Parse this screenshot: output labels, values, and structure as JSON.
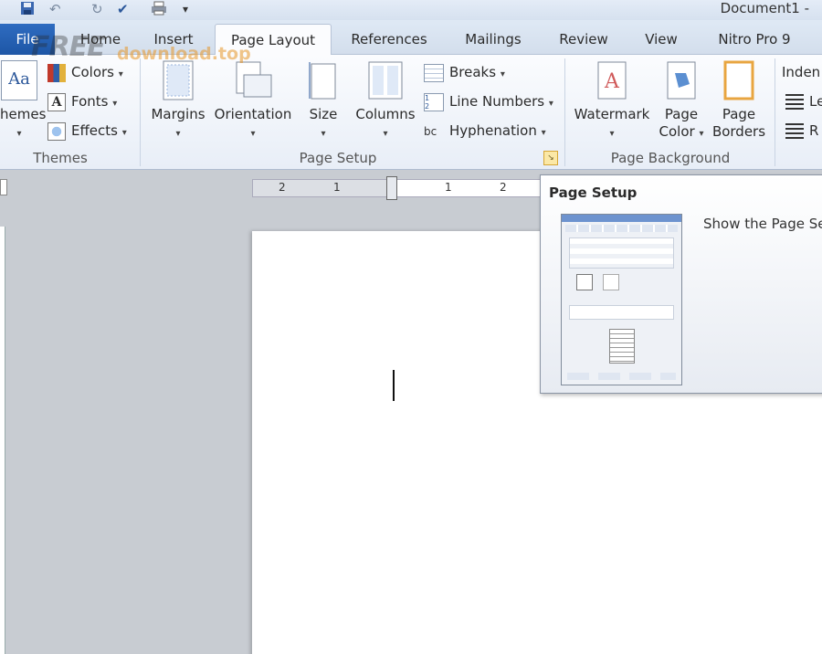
{
  "titlebar": {
    "document_title": "Document1 -"
  },
  "tabs": {
    "file": "File",
    "home": "Home",
    "insert": "Insert",
    "page_layout": "Page Layout",
    "references": "References",
    "mailings": "Mailings",
    "review": "Review",
    "view": "View",
    "nitro": "Nitro Pro 9"
  },
  "watermark": {
    "brand": "FREE",
    "site": "download.top"
  },
  "ribbon": {
    "themes": {
      "themes_btn": "hemes",
      "colors": "Colors",
      "fonts": "Fonts",
      "effects": "Effects",
      "label": "Themes"
    },
    "page_setup": {
      "margins": "Margins",
      "orientation": "Orientation",
      "size": "Size",
      "columns": "Columns",
      "breaks": "Breaks",
      "line_numbers": "Line Numbers",
      "hyphenation": "Hyphenation",
      "label": "Page Setup"
    },
    "page_background": {
      "watermark": "Watermark",
      "page_color_1": "Page",
      "page_color_2": "Color",
      "page_borders_1": "Page",
      "page_borders_2": "Borders",
      "label": "Page Background"
    },
    "paragraph": {
      "indent": "Inden",
      "left": "Le",
      "right": "R"
    }
  },
  "ruler": {
    "ticks": [
      "2",
      "1",
      "1",
      "2"
    ]
  },
  "tooltip": {
    "title": "Page Setup",
    "description": "Show the Page Se"
  },
  "colors": {
    "file_tab": "#2a66b8",
    "accent": "#2b579a"
  }
}
